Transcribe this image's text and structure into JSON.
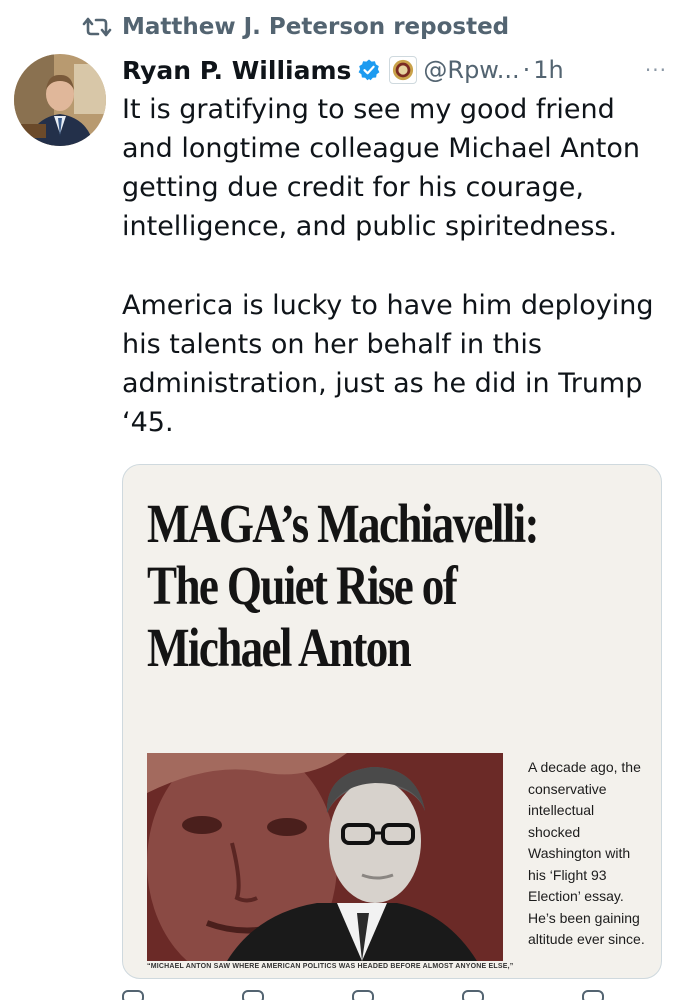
{
  "repost": {
    "label": "Matthew J. Peterson reposted",
    "icon": "repost-icon"
  },
  "author": {
    "name": "Ryan P. Williams",
    "handle": "@Rpw...",
    "separator": "·",
    "time": "1h",
    "verified_icon": "verified-badge-icon",
    "affiliation_icon": "affiliation-seal-icon",
    "more_icon": "more-options-icon",
    "more_label": "···"
  },
  "tweet": {
    "paragraphs": [
      "It is gratifying to see my good friend and longtime colleague Michael Anton getting due credit for his courage, intelligence, and public spiritedness.",
      "America is lucky to have him deploying his talents on her behalf in this administration, just as he did in Trump ‘45."
    ]
  },
  "card": {
    "headline_lines": [
      "MAGA’s Machiavelli:",
      "The Quiet Rise of",
      "Michael Anton"
    ],
    "side_text": "A decade ago, the conservative intellectual shocked Washington with his ‘Flight 93 Election’ essay. He’s been gaining altitude ever since.",
    "caption": "“MICHAEL ANTON SAW WHERE AMERICAN POLITICS WAS HEADED BEFORE ALMOST ANYONE ELSE,”"
  },
  "colors": {
    "verified": "#1d9bf0",
    "secondary_text": "#536471",
    "card_background": "#f3f1ec",
    "photo_background": "#6b2a27"
  }
}
